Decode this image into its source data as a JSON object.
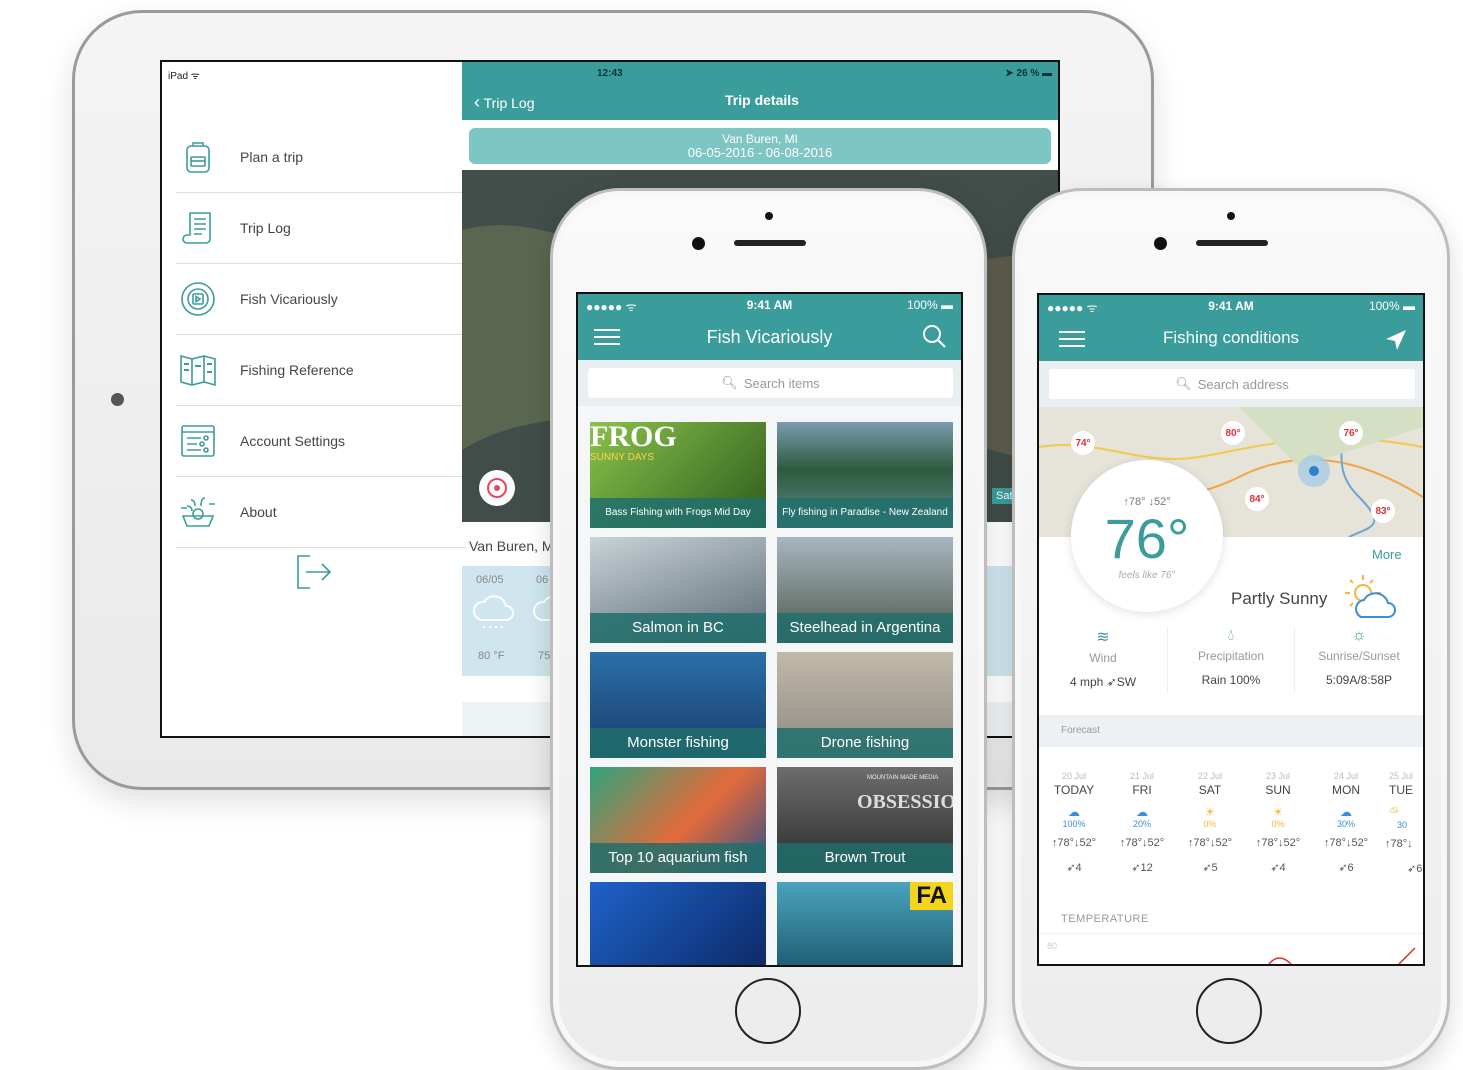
{
  "ipad": {
    "status": {
      "device": "iPad",
      "time": "12:43",
      "battery": "26 %"
    },
    "menu": [
      {
        "label": "Plan a trip",
        "icon": "backpack-icon"
      },
      {
        "label": "Trip Log",
        "icon": "scroll-icon"
      },
      {
        "label": "Fish Vicariously",
        "icon": "play-circle-icon"
      },
      {
        "label": "Fishing Reference",
        "icon": "map-book-icon"
      },
      {
        "label": "Account Settings",
        "icon": "settings-list-icon"
      },
      {
        "label": "About",
        "icon": "about-icon"
      }
    ],
    "trip": {
      "back_label": "Trip Log",
      "title": "Trip details",
      "location": "Van Buren, MI",
      "dates": "06-05-2016 - 06-08-2016",
      "location_short": "Van Buren, M",
      "sat_label": "Sat",
      "forecast": [
        {
          "date": "06/05",
          "temp": "80 °F"
        },
        {
          "date": "06",
          "temp": "75"
        }
      ]
    }
  },
  "phone1": {
    "status": {
      "signal": "●●●●● ᯤ",
      "time": "9:41 AM",
      "battery": "100%"
    },
    "title": "Fish Vicariously",
    "search_placeholder": "Search items",
    "tiles": [
      {
        "caption": "Bass Fishing with Frogs Mid Day",
        "overlay": "FROG",
        "overlay2": "SUNNY DAYS",
        "small": true
      },
      {
        "caption": "Fly fishing in Paradise - New Zealand",
        "small": true
      },
      {
        "caption": "Salmon in BC"
      },
      {
        "caption": "Steelhead in Argentina"
      },
      {
        "caption": "Monster fishing"
      },
      {
        "caption": "Drone fishing"
      },
      {
        "caption": "Top 10 aquarium fish"
      },
      {
        "caption": "Brown Trout",
        "overlay": "OBSESSION",
        "overlay2": "MOUNTAIN MADE MEDIA"
      },
      {
        "caption": ""
      },
      {
        "caption": "",
        "overlay": "FA"
      }
    ]
  },
  "phone2": {
    "status": {
      "signal": "●●●●● ᯤ",
      "time": "9:41 AM",
      "battery": "100%"
    },
    "title": "Fishing conditions",
    "search_placeholder": "Search address",
    "map_temps": [
      "74°",
      "80°",
      "76°",
      "84°",
      "83°"
    ],
    "current": {
      "hi_lo": "↑78° ↓52°",
      "temp": "76°",
      "feels": "feels like 76°",
      "condition": "Partly Sunny",
      "more": "More"
    },
    "stats": [
      {
        "label": "Wind",
        "value": "4 mph ➶SW"
      },
      {
        "label": "Precipitation",
        "value": "Rain 100%"
      },
      {
        "label": "Sunrise/Sunset",
        "value": "5:09A/8:58P"
      }
    ],
    "forecast_label": "Forecast",
    "days": [
      {
        "date": "20 Jul",
        "name": "TODAY",
        "pct": "100%",
        "hilo": "↑78°↓52°",
        "wind": "➶4"
      },
      {
        "date": "21 Jul",
        "name": "FRI",
        "pct": "20%",
        "hilo": "↑78°↓52°",
        "wind": "➶12"
      },
      {
        "date": "22 Jul",
        "name": "SAT",
        "pct": "0%",
        "hilo": "↑78°↓52°",
        "wind": "➶5"
      },
      {
        "date": "23 Jul",
        "name": "SUN",
        "pct": "0%",
        "hilo": "↑78°↓52°",
        "wind": "➶4"
      },
      {
        "date": "24 Jul",
        "name": "MON",
        "pct": "30%",
        "hilo": "↑78°↓52°",
        "wind": "➶6"
      },
      {
        "date": "25 Jul",
        "name": "TUE",
        "pct": "30",
        "hilo": "↑78°↓",
        "wind": "➶6"
      }
    ],
    "temperature_label": "TEMPERATURE",
    "chart_tick": "80"
  }
}
